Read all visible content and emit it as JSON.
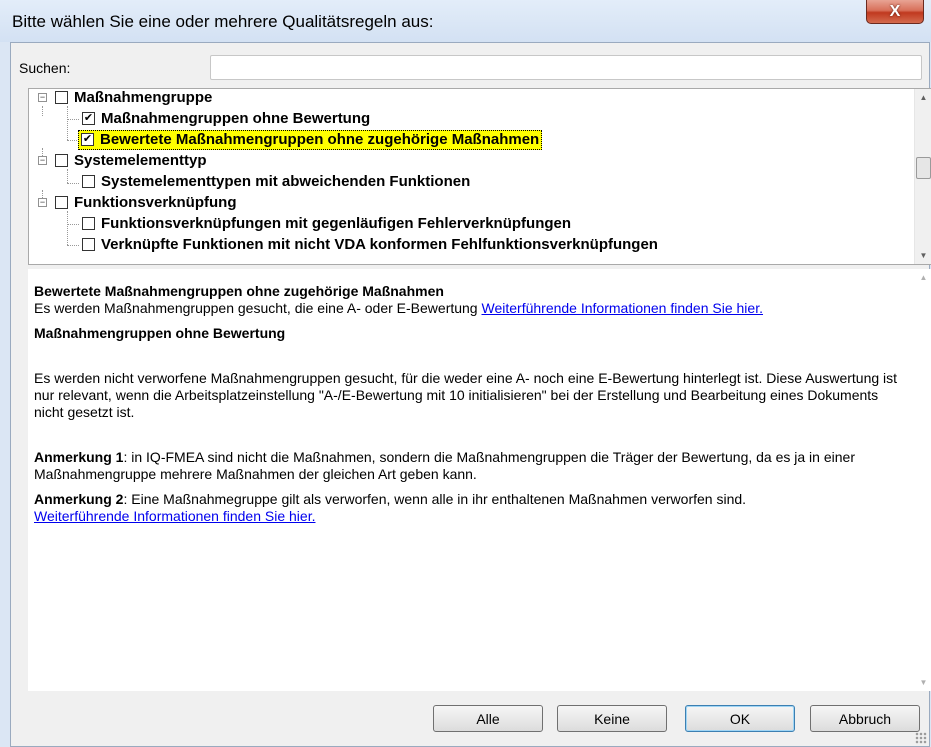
{
  "window": {
    "title": "Bitte wählen Sie eine oder mehrere Qualitätsregeln aus:",
    "close_glyph": "X"
  },
  "search": {
    "label": "Suchen:",
    "value": "",
    "placeholder": ""
  },
  "tree": {
    "expander_glyph": "−",
    "groups": [
      {
        "label": "Maßnahmengruppe",
        "checked": false,
        "children": [
          {
            "label": "Maßnahmengruppen ohne Bewertung",
            "checked": true,
            "selected": false
          },
          {
            "label": "Bewertete Maßnahmengruppen ohne zugehörige Maßnahmen",
            "checked": true,
            "selected": true
          }
        ]
      },
      {
        "label": "Systemelementtyp",
        "checked": false,
        "children": [
          {
            "label": "Systemelementtypen mit abweichenden Funktionen",
            "checked": false,
            "selected": false
          }
        ]
      },
      {
        "label": "Funktionsverknüpfung",
        "checked": false,
        "children": [
          {
            "label": "Funktionsverknüpfungen mit gegenläufigen Fehlerverknüpfungen",
            "checked": false,
            "selected": false
          },
          {
            "label": "Verknüpfte Funktionen mit nicht VDA konformen Fehlfunktionsverknüpfungen",
            "checked": false,
            "selected": false
          }
        ]
      }
    ]
  },
  "description": {
    "rule1_title": "Bewertete Maßnahmengruppen ohne zugehörige Maßnahmen",
    "rule1_text": "Es werden Maßnahmengruppen gesucht, die eine A- oder E-Bewertung ",
    "rule1_link": "Weiterführende Informationen finden Sie hier.",
    "rule2_title": "Maßnahmengruppen ohne Bewertung",
    "rule2_text": "Es werden nicht verworfene Maßnahmengruppen gesucht, für die weder eine A- noch eine E-Bewertung hinterlegt ist. Diese Auswertung ist nur relevant, wenn die Arbeitsplatzeinstellung \"A-/E-Bewertung mit 10 initialisieren\" bei der Erstellung und Bearbeitung eines Dokuments nicht gesetzt ist.",
    "note1_label": "Anmerkung 1",
    "note1_text": ": in IQ-FMEA sind nicht die Maßnahmen, sondern die  Maßnahmengruppen die Träger der Bewertung, da es ja in einer Maßnahmengruppe mehrere Maßnahmen der gleichen Art geben kann.",
    "note2_label": "Anmerkung 2",
    "note2_text": ": Eine Maßnahmegruppe gilt als verworfen, wenn alle in ihr enthaltenen Maßnahmen verworfen sind.",
    "rule2_link": "Weiterführende Informationen finden Sie hier."
  },
  "buttons": {
    "all": "Alle",
    "none": "Keine",
    "ok": "OK",
    "cancel": "Abbruch"
  },
  "colors": {
    "selection_highlight": "#ffff00",
    "link": "#0000ee",
    "close_button": "#c0391f"
  }
}
